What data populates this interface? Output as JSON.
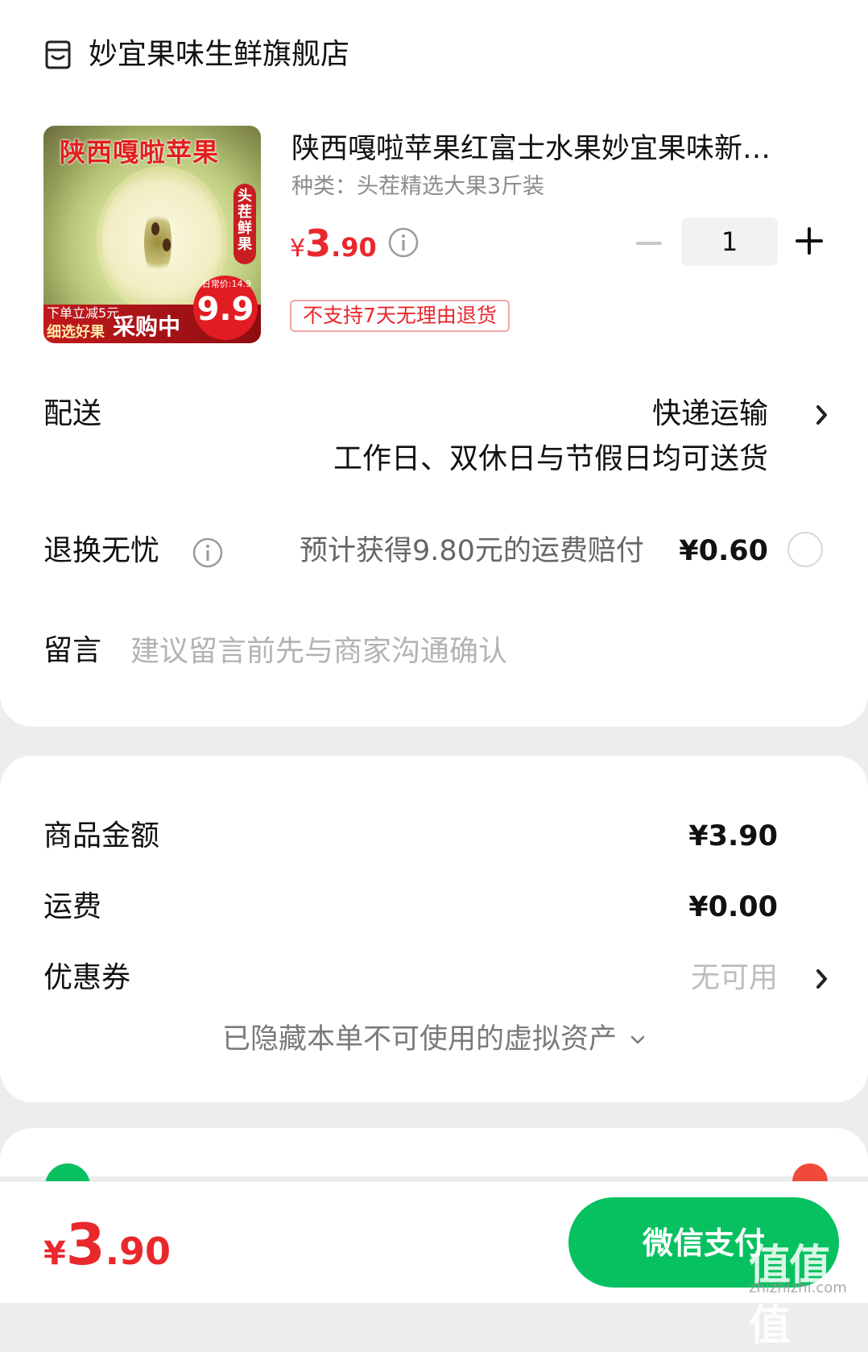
{
  "store": {
    "icon": "store-icon",
    "name": "妙宜果味生鲜旗舰店"
  },
  "product": {
    "image_title": "陕西嘎啦苹果",
    "image_badge": "头茬鲜果",
    "image_promo": "下单立减5元",
    "image_sub": "细选好果",
    "image_buy": "采购中",
    "image_price": "9.9",
    "image_price_tag": "日常价:14.9",
    "title": "陕西嘎啦苹果红富士水果妙宜果味新…",
    "spec": "种类：头茬精选大果3斤装",
    "price_symbol": "¥",
    "price_int": "3",
    "price_dec": ".90",
    "quantity": "1",
    "return_policy": "不支持7天无理由退货"
  },
  "delivery": {
    "label": "配送",
    "method": "快递运输",
    "note": "工作日、双休日与节假日均可送货"
  },
  "return_insurance": {
    "label": "退换无忧",
    "desc": "预计获得9.80元的运费赔付",
    "price": "¥0.60"
  },
  "message": {
    "label": "留言",
    "placeholder": "建议留言前先与商家沟通确认"
  },
  "summary": {
    "goods_label": "商品金额",
    "goods_value": "¥3.90",
    "shipping_label": "运费",
    "shipping_value": "¥0.00",
    "coupon_label": "优惠券",
    "coupon_value": "无可用",
    "hidden_assets": "已隐藏本单不可使用的虚拟资产"
  },
  "footer": {
    "price_symbol": "¥",
    "price_int": "3",
    "price_dec": ".90",
    "pay_label": "微信支付",
    "watermark": "值值值",
    "watermark_sub": "zhizhizhi.com"
  },
  "colors": {
    "accent_red": "#e8282d",
    "wechat_green": "#07c160"
  }
}
